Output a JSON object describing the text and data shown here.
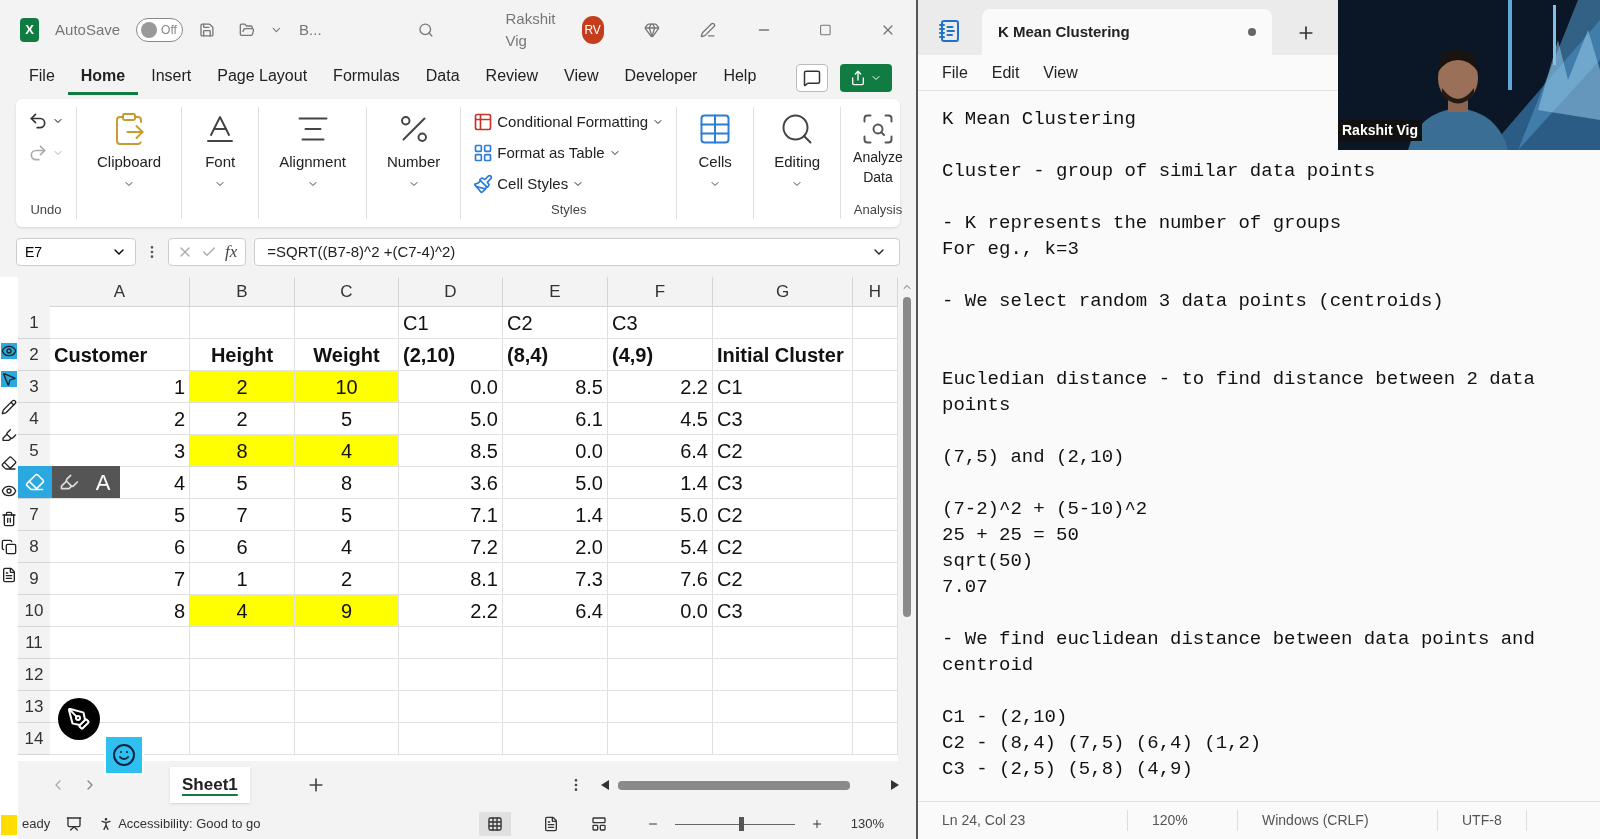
{
  "excel": {
    "title_bar": {
      "logo_letter": "X",
      "autosave_label": "AutoSave",
      "autosave": {
        "on": false,
        "label": "Off"
      },
      "file_name": "B...",
      "user_name": "Rakshit Vig",
      "avatar_initials": "RV"
    },
    "tabs": [
      {
        "label": "File",
        "selected": false
      },
      {
        "label": "Home",
        "selected": true
      },
      {
        "label": "Insert",
        "selected": false
      },
      {
        "label": "Page Layout",
        "selected": false
      },
      {
        "label": "Formulas",
        "selected": false
      },
      {
        "label": "Data",
        "selected": false
      },
      {
        "label": "Review",
        "selected": false
      },
      {
        "label": "View",
        "selected": false
      },
      {
        "label": "Developer",
        "selected": false
      },
      {
        "label": "Help",
        "selected": false
      }
    ],
    "ribbon": {
      "undo_group": "Undo",
      "groups": [
        {
          "kind": "clipboard",
          "label": "Clipboard"
        },
        {
          "kind": "font",
          "label": "Font"
        },
        {
          "kind": "alignment",
          "label": "Alignment"
        },
        {
          "kind": "number",
          "label": "Number"
        }
      ],
      "styles": {
        "label": "Styles",
        "items": [
          {
            "kind": "conditional",
            "label": "Conditional Formatting"
          },
          {
            "kind": "table",
            "label": "Format as Table"
          },
          {
            "kind": "cellstyles",
            "label": "Cell Styles"
          }
        ]
      },
      "groups_after": [
        {
          "kind": "cells",
          "label": "Cells"
        },
        {
          "kind": "editing",
          "label": "Editing"
        }
      ],
      "analysis": {
        "button": "Analyze\nData",
        "label": "Analysis"
      }
    },
    "formula_bar": {
      "name_box": "E7",
      "fx": "fx",
      "formula": "=SQRT((B7-8)^2 +(C7-4)^2)"
    },
    "columns": [
      {
        "label": "A"
      },
      {
        "label": "B"
      },
      {
        "label": "C"
      },
      {
        "label": "D"
      },
      {
        "label": "E"
      },
      {
        "label": "F"
      },
      {
        "label": "G"
      },
      {
        "label": "H"
      }
    ],
    "rows": [
      {
        "number": "1",
        "cells": [
          {},
          {},
          {},
          {
            "text": "C1"
          },
          {
            "text": "C2"
          },
          {
            "text": "C3"
          },
          {},
          {}
        ]
      },
      {
        "number": "2",
        "cells": [
          {
            "text": "Customer",
            "bold": true
          },
          {
            "text": "Height",
            "bold": true,
            "centered": true
          },
          {
            "text": "Weight",
            "bold": true,
            "centered": true
          },
          {
            "text": "(2,10)",
            "bold": true
          },
          {
            "text": "(8,4)",
            "bold": true
          },
          {
            "text": "(4,9)",
            "bold": true
          },
          {
            "text": "Initial Cluster",
            "bold": true
          },
          {}
        ]
      },
      {
        "number": "3",
        "cells": [
          {
            "text": "1",
            "kind": "number"
          },
          {
            "text": "2",
            "centered": true,
            "highlighted": true
          },
          {
            "text": "10",
            "centered": true,
            "highlighted": true
          },
          {
            "text": "0.0",
            "kind": "number"
          },
          {
            "text": "8.5",
            "kind": "number"
          },
          {
            "text": "2.2",
            "kind": "number"
          },
          {
            "text": "C1"
          },
          {}
        ]
      },
      {
        "number": "4",
        "cells": [
          {
            "text": "2",
            "kind": "number"
          },
          {
            "text": "2",
            "centered": true,
            "highlighted": false
          },
          {
            "text": "5",
            "centered": true,
            "highlighted": false
          },
          {
            "text": "5.0",
            "kind": "number"
          },
          {
            "text": "6.1",
            "kind": "number"
          },
          {
            "text": "4.5",
            "kind": "number"
          },
          {
            "text": "C3"
          },
          {}
        ]
      },
      {
        "number": "5",
        "cells": [
          {
            "text": "3",
            "kind": "number"
          },
          {
            "text": "8",
            "centered": true,
            "highlighted": true
          },
          {
            "text": "4",
            "centered": true,
            "highlighted": true
          },
          {
            "text": "8.5",
            "kind": "number"
          },
          {
            "text": "0.0",
            "kind": "number"
          },
          {
            "text": "6.4",
            "kind": "number"
          },
          {
            "text": "C2"
          },
          {}
        ]
      },
      {
        "cells": [
          {
            "text": "4",
            "kind": "number"
          },
          {
            "text": "5",
            "centered": true,
            "highlighted": false
          },
          {
            "text": "8",
            "centered": true,
            "highlighted": false
          },
          {
            "text": "3.6",
            "kind": "number"
          },
          {
            "text": "5.0",
            "kind": "number"
          },
          {
            "text": "1.4",
            "kind": "number"
          },
          {
            "text": "C3"
          },
          {}
        ]
      },
      {
        "number": "7",
        "cells": [
          {
            "text": "5",
            "kind": "number"
          },
          {
            "text": "7",
            "centered": true,
            "highlighted": false
          },
          {
            "text": "5",
            "centered": true,
            "highlighted": false
          },
          {
            "text": "7.1",
            "kind": "number"
          },
          {
            "text": "1.4",
            "kind": "number"
          },
          {
            "text": "5.0",
            "kind": "number"
          },
          {
            "text": "C2"
          },
          {}
        ]
      },
      {
        "number": "8",
        "cells": [
          {
            "text": "6",
            "kind": "number"
          },
          {
            "text": "6",
            "centered": true,
            "highlighted": false
          },
          {
            "text": "4",
            "centered": true,
            "highlighted": false
          },
          {
            "text": "7.2",
            "kind": "number"
          },
          {
            "text": "2.0",
            "kind": "number"
          },
          {
            "text": "5.4",
            "kind": "number"
          },
          {
            "text": "C2"
          },
          {}
        ]
      },
      {
        "number": "9",
        "cells": [
          {
            "text": "7",
            "kind": "number"
          },
          {
            "text": "1",
            "centered": true,
            "highlighted": false
          },
          {
            "text": "2",
            "centered": true,
            "highlighted": false
          },
          {
            "text": "8.1",
            "kind": "number"
          },
          {
            "text": "7.3",
            "kind": "number"
          },
          {
            "text": "7.6",
            "kind": "number"
          },
          {
            "text": "C2"
          },
          {}
        ]
      },
      {
        "number": "10",
        "cells": [
          {
            "text": "8",
            "kind": "number"
          },
          {
            "text": "4",
            "centered": true,
            "highlighted": true
          },
          {
            "text": "9",
            "centered": true,
            "highlighted": true
          },
          {
            "text": "2.2",
            "kind": "number"
          },
          {
            "text": "6.4",
            "kind": "number"
          },
          {
            "text": "0.0",
            "kind": "number"
          },
          {
            "text": "C3"
          },
          {}
        ]
      },
      {
        "number": "11",
        "cells": [
          {},
          {},
          {},
          {},
          {},
          {},
          {},
          {}
        ]
      },
      {
        "number": "12",
        "cells": [
          {},
          {},
          {},
          {},
          {},
          {},
          {},
          {}
        ]
      },
      {
        "number": "13",
        "cells": [
          {},
          {},
          {},
          {},
          {},
          {},
          {},
          {}
        ]
      },
      {
        "number": "14",
        "cells": [
          {},
          {},
          {},
          {},
          {},
          {},
          {},
          {}
        ]
      }
    ],
    "annotation_toolbar": {
      "text_tool": "A"
    },
    "sheets": [
      {
        "label": "Sheet1",
        "selected": true
      }
    ],
    "status_bar": {
      "mode": "eady",
      "accessibility": "Accessibility: Good to go",
      "zoom": {
        "level": 0.55
      },
      "zoom_label": "130%"
    }
  },
  "notepad": {
    "tab": {
      "title": "K Mean Clustering",
      "unsaved": true
    },
    "menu": [
      "File",
      "Edit",
      "View"
    ],
    "content": "K Mean Clustering\n\nCluster - group of similar data points\n\n- K represents the number of groups\nFor eg., k=3\n\n- We select random 3 data points (centroids)\n\n\nEucledian distance - to find distance between 2 data\npoints\n\n(7,5) and (2,10)\n\n(7-2)^2 + (5-10)^2\n25 + 25 = 50\nsqrt(50)\n7.07\n\n- We find euclidean distance between data points and\ncentroid\n\nC1 - (2,10)\nC2 - (8,4) (7,5) (6,4) (1,2)\nC3 - (2,5) (5,8) (4,9)",
    "status_bar": [
      "Ln 24, Col 23",
      "120%",
      "Windows (CRLF)",
      "UTF-8"
    ]
  },
  "webcam": {
    "name": "Rakshit Vig"
  }
}
